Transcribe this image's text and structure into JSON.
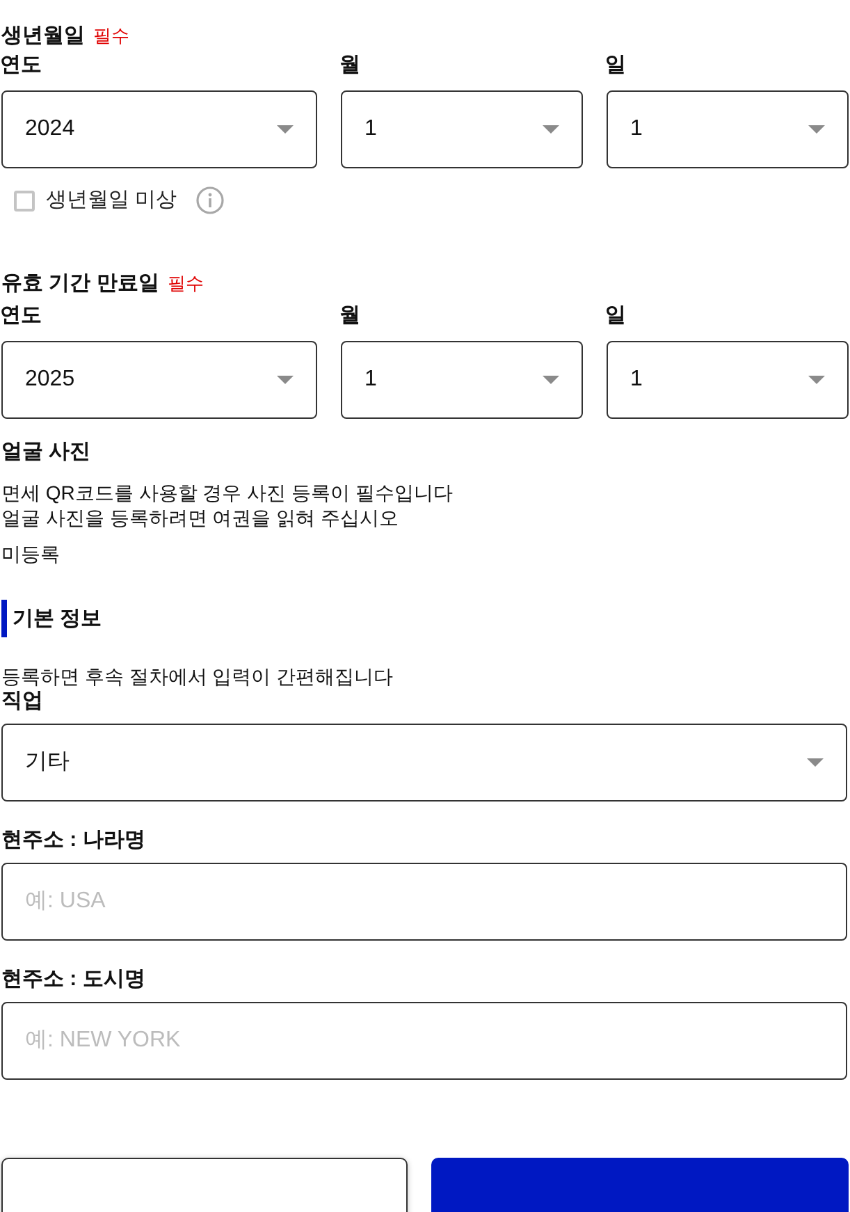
{
  "birth_date": {
    "title": "생년월일",
    "required_badge": "필수",
    "fields": [
      {
        "label": "연도",
        "value": "2024"
      },
      {
        "label": "월",
        "value": "1"
      },
      {
        "label": "일",
        "value": "1"
      }
    ],
    "unknown_checkbox": {
      "label": "생년월일 미상",
      "checked": false
    }
  },
  "expiry_date": {
    "title": "유효 기간 만료일",
    "required_badge": "필수",
    "fields": [
      {
        "label": "연도",
        "value": "2025"
      },
      {
        "label": "월",
        "value": "1"
      },
      {
        "label": "일",
        "value": "1"
      }
    ]
  },
  "face_photo": {
    "title": "얼굴 사진",
    "description": [
      "면세 QR코드를 사용할 경우 사진 등록이 필수입니다",
      "얼굴 사진을 등록하려면 여권을 읽혀 주십시오"
    ],
    "status": "미등록"
  },
  "basic_info": {
    "title": "기본 정보",
    "description": "등록하면 후속 절차에서 입력이 간편해집니다",
    "fields": [
      {
        "kind": "select",
        "label": "직업",
        "value": "기타"
      },
      {
        "kind": "text",
        "label": "현주소 : 나라명",
        "placeholder": "예: USA"
      },
      {
        "kind": "text",
        "label": "현주소 : 도시명",
        "placeholder": "예: NEW YORK"
      }
    ]
  },
  "buttons": [
    {
      "kind": "outline"
    },
    {
      "kind": "primary"
    }
  ]
}
